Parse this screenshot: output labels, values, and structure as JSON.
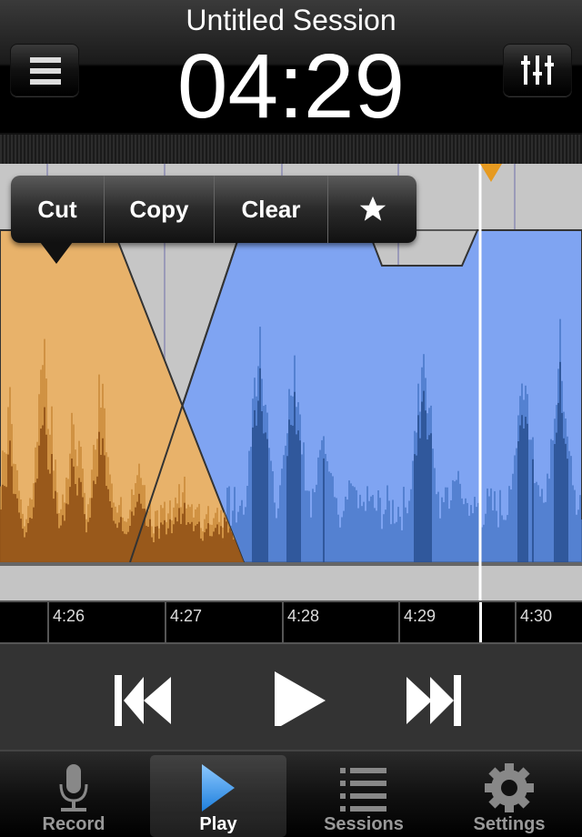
{
  "header": {
    "title": "Untitled Session",
    "time": "04:29",
    "menu_icon": "hamburger-icon",
    "mixer_icon": "sliders-icon"
  },
  "edit_menu": {
    "items": [
      "Cut",
      "Copy",
      "Clear"
    ],
    "favorite_icon": "star-icon"
  },
  "timeline": {
    "ticks": [
      "4:26",
      "4:27",
      "4:28",
      "4:29",
      "4:30"
    ],
    "playhead": "4:29"
  },
  "colors": {
    "clip_a": "#e8b26a",
    "clip_b": "#7fa4f2",
    "playhead": "#ffffff",
    "marker": "#e69a20",
    "active_tab": "#3fa0ec"
  },
  "transport": {
    "rewind_icon": "skip-back-icon",
    "play_icon": "play-icon",
    "forward_icon": "skip-forward-icon"
  },
  "tabs": [
    {
      "label": "Record",
      "icon": "microphone-icon"
    },
    {
      "label": "Play",
      "icon": "play-icon",
      "active": true
    },
    {
      "label": "Sessions",
      "icon": "list-icon"
    },
    {
      "label": "Settings",
      "icon": "gear-icon"
    }
  ]
}
